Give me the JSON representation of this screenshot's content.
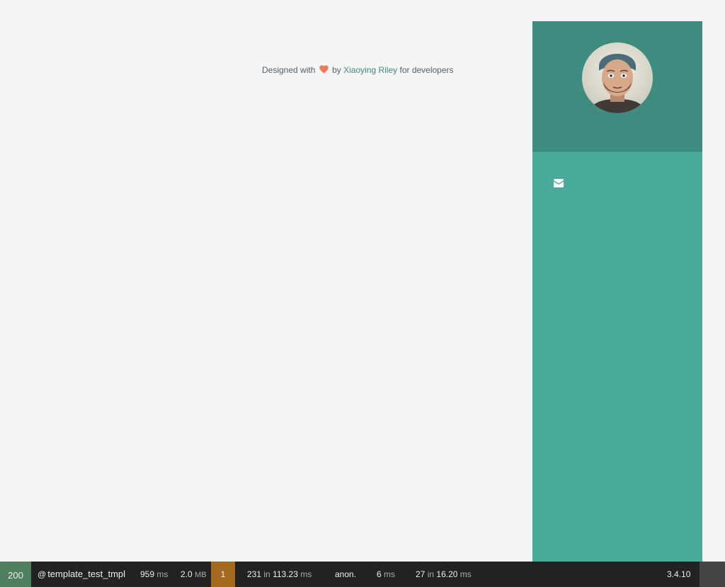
{
  "credit": {
    "prefix": "Designed with",
    "by": "by",
    "author": "Xiaoying Riley",
    "suffix": "for developers"
  },
  "sidebar": {
    "contact_icon": "envelope-icon"
  },
  "toolbar": {
    "status": "200",
    "at": "@",
    "route": "template_test_tmpl",
    "time_value": "959",
    "time_unit": "ms",
    "memory_value": "2.0",
    "memory_unit": "MB",
    "warnings": "1",
    "twig_calls": "231",
    "in_1": "in",
    "twig_time": "113.23",
    "twig_unit": "ms",
    "user": "anon.",
    "db_time": "6",
    "db_unit": "ms",
    "queries": "27",
    "in_2": "in",
    "query_time": "16.20",
    "query_unit": "ms",
    "version": "3.4.10"
  },
  "colors": {
    "background": "#f5f5f5",
    "sidebar": "#4aab9b",
    "profile": "#3d8c7f",
    "heart": "#f0795b",
    "link": "#3d8a7f",
    "status_ok": "#4f805d",
    "warning": "#a46a1f"
  }
}
